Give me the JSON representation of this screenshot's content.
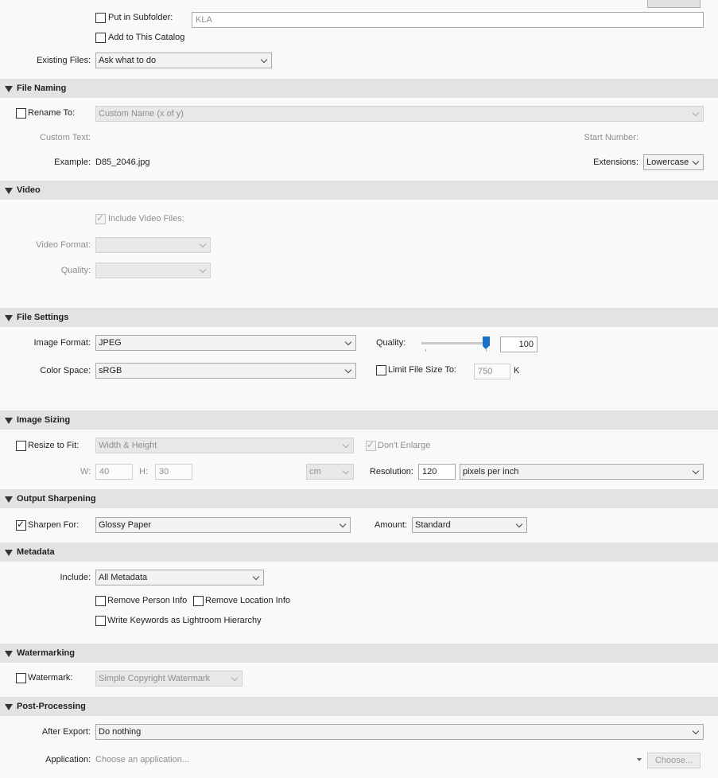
{
  "export_location": {
    "put_in_subfolder_label": "Put in Subfolder:",
    "subfolder_placeholder": "KLA",
    "add_to_catalog_label": "Add to This Catalog",
    "existing_files_label": "Existing Files:",
    "existing_files_value": "Ask what to do"
  },
  "file_naming": {
    "title": "File Naming",
    "rename_to_label": "Rename To:",
    "rename_to_value": "Custom Name (x of y)",
    "custom_text_label": "Custom Text:",
    "start_number_label": "Start Number:",
    "example_label": "Example:",
    "example_value": "D85_2046.jpg",
    "extensions_label": "Extensions:",
    "extensions_value": "Lowercase"
  },
  "video": {
    "title": "Video",
    "include_video_label": "Include Video Files:",
    "video_format_label": "Video Format:",
    "quality_label": "Quality:"
  },
  "file_settings": {
    "title": "File Settings",
    "image_format_label": "Image Format:",
    "image_format_value": "JPEG",
    "color_space_label": "Color Space:",
    "color_space_value": "sRGB",
    "quality_label": "Quality:",
    "quality_value": "100",
    "quality_fraction": 1.0,
    "limit_file_size_label": "Limit File Size To:",
    "limit_file_size_value": "750",
    "limit_file_size_unit": "K"
  },
  "image_sizing": {
    "title": "Image Sizing",
    "resize_to_fit_label": "Resize to Fit:",
    "resize_mode_value": "Width & Height",
    "dont_enlarge_label": "Don't Enlarge",
    "w_label": "W:",
    "w_value": "40",
    "h_label": "H:",
    "h_value": "30",
    "unit_value": "cm",
    "resolution_label": "Resolution:",
    "resolution_value": "120",
    "resolution_unit_value": "pixels per inch"
  },
  "output_sharpening": {
    "title": "Output Sharpening",
    "sharpen_for_label": "Sharpen For:",
    "sharpen_for_value": "Glossy Paper",
    "amount_label": "Amount:",
    "amount_value": "Standard"
  },
  "metadata": {
    "title": "Metadata",
    "include_label": "Include:",
    "include_value": "All Metadata",
    "remove_person_label": "Remove Person Info",
    "remove_location_label": "Remove Location Info",
    "write_keywords_label": "Write Keywords as Lightroom Hierarchy"
  },
  "watermarking": {
    "title": "Watermarking",
    "watermark_label": "Watermark:",
    "watermark_value": "Simple Copyright Watermark"
  },
  "post_processing": {
    "title": "Post-Processing",
    "after_export_label": "After Export:",
    "after_export_value": "Do nothing",
    "application_label": "Application:",
    "application_placeholder": "Choose an application...",
    "choose_button_label": "Choose..."
  },
  "colors": {
    "section_header_bg": "#e3e3e3",
    "panel_bg": "#f9f9f9",
    "slider_thumb": "#1a73c8"
  }
}
